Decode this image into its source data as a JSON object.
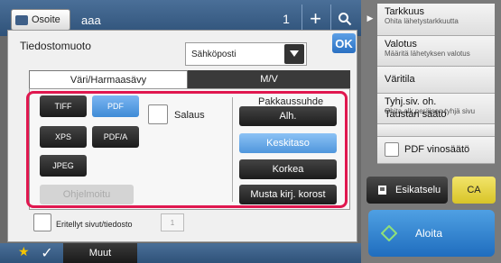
{
  "header": {
    "address_label": "Osoite",
    "address_value": "aaa",
    "destination_count": "1"
  },
  "dialog": {
    "format_label": "Tiedostomuoto",
    "format_select_value": "Sähköposti",
    "ok_label": "OK",
    "tabs": {
      "color": "Väri/Harmaasävy",
      "mono": "M/V"
    },
    "file_types": {
      "tiff": "TIFF",
      "pdf": "PDF",
      "xps": "XPS",
      "pdfa": "PDF/A",
      "jpeg": "JPEG"
    },
    "programmed_label": "Ohjelmoitu",
    "encryption_label": "Salaus",
    "compression": {
      "title": "Pakkaussuhde",
      "options": [
        "Alh.",
        "Keskitaso",
        "Korkea",
        "Musta kirj. korost"
      ],
      "selected": "Keskitaso"
    },
    "separate_pages": {
      "label": "Eritellyt sivut/tiedosto",
      "value": "1"
    }
  },
  "bottom": {
    "other_label": "Muut"
  },
  "right_panel": {
    "items": [
      {
        "title": "Tarkkuus",
        "subtitle": "Ohita lähetystarkkuutta"
      },
      {
        "title": "Valotus",
        "subtitle": "Määritä lähetyksen valotus"
      },
      {
        "title": "Väritila",
        "subtitle": ""
      },
      {
        "title": "Tyhj.siv. oh.",
        "subtitle": "Ohita alk.peräisen tyhjä sivu"
      },
      {
        "title": "Taustan säätö",
        "subtitle": ""
      }
    ],
    "pdf_tilt_label": "PDF vinosäätö",
    "preview_label": "Esikatselu",
    "ca_label": "CA",
    "start_label": "Aloita"
  },
  "colors": {
    "accent": "#3f8bd6",
    "highlight": "#e0174f",
    "bar": "#2f5279",
    "start": "#1f6dbe",
    "ca": "#d8c428"
  }
}
